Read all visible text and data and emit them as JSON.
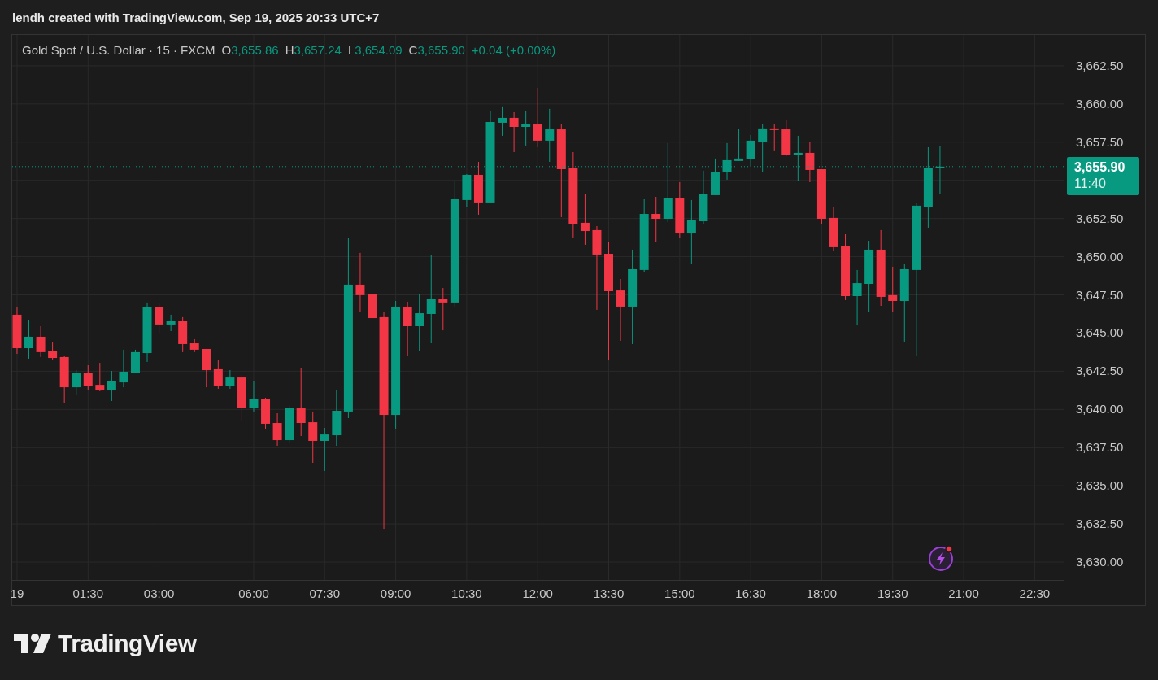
{
  "attribution": "lendh created with TradingView.com, Sep 19, 2025 20:33 UTC+7",
  "legend": {
    "symbol": "Gold Spot / U.S. Dollar · 15 · FXCM",
    "fields": [
      {
        "label": "O",
        "value": "3,655.86"
      },
      {
        "label": "H",
        "value": "3,657.24"
      },
      {
        "label": "L",
        "value": "3,654.09"
      },
      {
        "label": "C",
        "value": "3,655.90"
      }
    ],
    "change": "+0.04 (+0.00%)"
  },
  "price_tag": {
    "price": "3,655.90",
    "countdown": "11:40"
  },
  "chart_data": {
    "type": "candlestick",
    "grid": true,
    "ylim": [
      3628.83,
      3664.52
    ],
    "yticks": [
      {
        "value": 3630,
        "label": "3,630.00"
      },
      {
        "value": 3632.5,
        "label": "3,632.50"
      },
      {
        "value": 3635,
        "label": "3,635.00"
      },
      {
        "value": 3637.5,
        "label": "3,637.50"
      },
      {
        "value": 3640,
        "label": "3,640.00"
      },
      {
        "value": 3642.5,
        "label": "3,642.50"
      },
      {
        "value": 3645,
        "label": "3,645.00"
      },
      {
        "value": 3647.5,
        "label": "3,647.50"
      },
      {
        "value": 3650,
        "label": "3,650.00"
      },
      {
        "value": 3652.5,
        "label": "3,652.50"
      },
      {
        "value": 3657.5,
        "label": "3,657.50"
      },
      {
        "value": 3660,
        "label": "3,660.00"
      },
      {
        "value": 3662.5,
        "label": "3,662.50"
      }
    ],
    "ref_lines": [
      {
        "axis": "y",
        "value": 3655.9
      }
    ],
    "categories": [
      "19",
      null,
      null,
      null,
      null,
      null,
      "01:30",
      null,
      null,
      null,
      null,
      null,
      "03:00",
      null,
      null,
      null,
      null,
      null,
      null,
      null,
      "06:00",
      null,
      null,
      null,
      null,
      null,
      "07:30",
      null,
      null,
      null,
      null,
      null,
      "09:00",
      null,
      null,
      null,
      null,
      null,
      "10:30",
      null,
      null,
      null,
      null,
      null,
      "12:00",
      null,
      null,
      null,
      null,
      null,
      "13:30",
      null,
      null,
      null,
      null,
      null,
      "15:00",
      null,
      null,
      null,
      null,
      null,
      "16:30",
      null,
      null,
      null,
      null,
      null,
      "18:00",
      null,
      null,
      null,
      null,
      null,
      "19:30",
      null,
      null,
      null,
      null,
      null,
      "21:00",
      null,
      null,
      null,
      null,
      null,
      "22:30",
      null,
      null
    ],
    "ohlc": [
      [
        3646.2,
        3646.68,
        3643.64,
        3644.01
      ],
      [
        3644.01,
        3645.82,
        3643.32,
        3644.76
      ],
      [
        3644.76,
        3645.45,
        3643.43,
        3643.75
      ],
      [
        3643.8,
        3644.38,
        3643.27,
        3643.37
      ],
      [
        3643.43,
        3643.48,
        3640.39,
        3641.45
      ],
      [
        3641.45,
        3642.57,
        3640.92,
        3642.36
      ],
      [
        3642.36,
        3642.89,
        3641.29,
        3641.56
      ],
      [
        3641.61,
        3643.05,
        3641.19,
        3641.24
      ],
      [
        3641.24,
        3642.52,
        3640.55,
        3641.83
      ],
      [
        3641.77,
        3643.91,
        3641.45,
        3642.47
      ],
      [
        3642.41,
        3643.91,
        3642.36,
        3643.75
      ],
      [
        3643.69,
        3647.0,
        3643.11,
        3646.68
      ],
      [
        3646.68,
        3647.0,
        3644.97,
        3645.56
      ],
      [
        3645.56,
        3646.2,
        3645.13,
        3645.77
      ],
      [
        3645.77,
        3646.04,
        3643.75,
        3644.28
      ],
      [
        3644.33,
        3644.6,
        3643.75,
        3643.91
      ],
      [
        3643.96,
        3643.96,
        3641.45,
        3642.57
      ],
      [
        3642.63,
        3643.21,
        3641.35,
        3641.56
      ],
      [
        3641.56,
        3642.57,
        3641.35,
        3642.09
      ],
      [
        3642.09,
        3642.25,
        3639.27,
        3640.07
      ],
      [
        3640.07,
        3641.83,
        3639.86,
        3640.66
      ],
      [
        3640.66,
        3640.76,
        3638.74,
        3639.06
      ],
      [
        3639.11,
        3639.75,
        3637.62,
        3637.99
      ],
      [
        3637.99,
        3640.23,
        3637.78,
        3640.07
      ],
      [
        3640.07,
        3642.68,
        3638.26,
        3639.11
      ],
      [
        3639.16,
        3639.86,
        3636.5,
        3637.94
      ],
      [
        3637.94,
        3638.79,
        3635.97,
        3638.36
      ],
      [
        3638.31,
        3641.24,
        3637.62,
        3639.91
      ],
      [
        3639.86,
        3651.2,
        3639.43,
        3648.17
      ],
      [
        3648.17,
        3650.25,
        3646.41,
        3647.48
      ],
      [
        3647.53,
        3648.33,
        3645.18,
        3645.98
      ],
      [
        3646.04,
        3646.41,
        3632.18,
        3639.64
      ],
      [
        3639.64,
        3647.1,
        3638.74,
        3646.73
      ],
      [
        3646.73,
        3647.05,
        3643.48,
        3645.45
      ],
      [
        3645.45,
        3647.58,
        3643.8,
        3646.3
      ],
      [
        3646.25,
        3650.09,
        3644.33,
        3647.21
      ],
      [
        3647.21,
        3647.95,
        3645.18,
        3647.0
      ],
      [
        3647.0,
        3654.93,
        3646.68,
        3653.76
      ],
      [
        3653.71,
        3655.41,
        3653.28,
        3655.36
      ],
      [
        3655.36,
        3656.21,
        3652.75,
        3653.55
      ],
      [
        3653.55,
        3659.52,
        3653.55,
        3658.82
      ],
      [
        3658.77,
        3659.84,
        3657.92,
        3659.09
      ],
      [
        3659.09,
        3659.46,
        3656.85,
        3658.5
      ],
      [
        3658.5,
        3659.57,
        3657.28,
        3658.66
      ],
      [
        3658.66,
        3661.06,
        3657.17,
        3657.6
      ],
      [
        3657.6,
        3659.68,
        3656.21,
        3658.34
      ],
      [
        3658.34,
        3658.66,
        3652.59,
        3655.73
      ],
      [
        3655.79,
        3656.85,
        3651.26,
        3652.16
      ],
      [
        3652.22,
        3654.08,
        3650.78,
        3651.68
      ],
      [
        3651.74,
        3652.0,
        3646.52,
        3650.14
      ],
      [
        3650.19,
        3650.94,
        3643.21,
        3647.74
      ],
      [
        3647.79,
        3648.54,
        3644.49,
        3646.73
      ],
      [
        3646.73,
        3650.46,
        3644.28,
        3649.18
      ],
      [
        3649.13,
        3653.76,
        3648.97,
        3652.8
      ],
      [
        3652.8,
        3653.92,
        3650.94,
        3652.48
      ],
      [
        3652.48,
        3657.44,
        3652.27,
        3653.82
      ],
      [
        3653.82,
        3654.88,
        3651.2,
        3651.52
      ],
      [
        3651.52,
        3653.71,
        3649.5,
        3652.38
      ],
      [
        3652.32,
        3655.63,
        3652.16,
        3654.08
      ],
      [
        3654.03,
        3656.43,
        3654.03,
        3655.57
      ],
      [
        3655.52,
        3657.44,
        3655.04,
        3656.32
      ],
      [
        3656.27,
        3658.34,
        3656.27,
        3656.43
      ],
      [
        3656.37,
        3657.97,
        3655.89,
        3657.6
      ],
      [
        3657.54,
        3658.66,
        3655.52,
        3658.4
      ],
      [
        3658.4,
        3658.66,
        3656.91,
        3658.34
      ],
      [
        3658.34,
        3658.98,
        3656.59,
        3656.64
      ],
      [
        3656.64,
        3657.92,
        3654.93,
        3656.8
      ],
      [
        3656.8,
        3657.49,
        3654.88,
        3655.68
      ],
      [
        3655.73,
        3655.73,
        3652.11,
        3652.48
      ],
      [
        3652.54,
        3653.28,
        3650.35,
        3650.62
      ],
      [
        3650.67,
        3651.47,
        3647.16,
        3647.42
      ],
      [
        3647.42,
        3649.13,
        3645.5,
        3648.27
      ],
      [
        3648.22,
        3651.04,
        3646.41,
        3650.46
      ],
      [
        3650.46,
        3651.74,
        3646.78,
        3647.37
      ],
      [
        3647.48,
        3649.34,
        3646.41,
        3647.1
      ],
      [
        3647.1,
        3649.55,
        3644.44,
        3649.18
      ],
      [
        3649.13,
        3653.5,
        3643.48,
        3653.34
      ],
      [
        3653.28,
        3657.17,
        3651.9,
        3655.79
      ],
      [
        3655.86,
        3657.24,
        3654.09,
        3655.9
      ],
      null,
      null,
      null,
      null,
      null,
      null,
      null,
      null,
      null,
      null
    ]
  },
  "brand": {
    "name": "TradingView"
  }
}
